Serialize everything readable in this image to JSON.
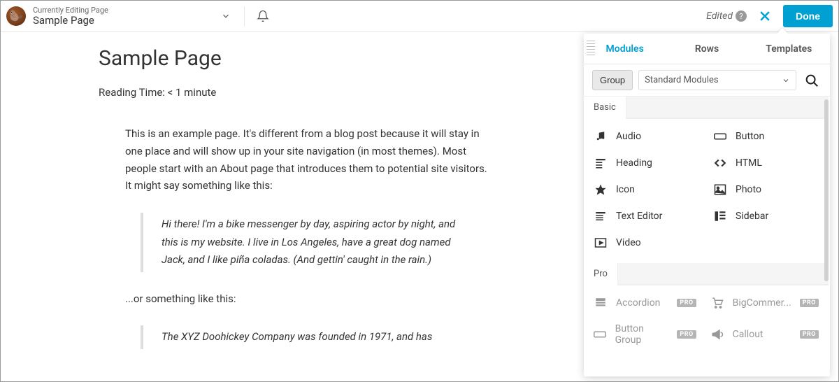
{
  "topbar": {
    "editing_label": "Currently Editing Page",
    "page_name": "Sample Page",
    "edited_label": "Edited",
    "done_label": "Done"
  },
  "content": {
    "title": "Sample Page",
    "reading_time": "Reading Time: < 1 minute",
    "para1": "This is an example page. It's different from a blog post because it will stay in one place and will show up in your site navigation (in most themes). Most people start with an About page that introduces them to potential site visitors. It might say something like this:",
    "quote1": "Hi there! I'm a bike messenger by day, aspiring actor by night, and this is my website. I live in Los Angeles, have a great dog named Jack, and I like piña coladas. (And gettin' caught in the rain.)",
    "para2": "...or something like this:",
    "quote2": "The XYZ Doohickey Company was founded in 1971, and has"
  },
  "panel": {
    "tabs": [
      "Modules",
      "Rows",
      "Templates"
    ],
    "active_tab": 0,
    "group_label": "Group",
    "filter_value": "Standard Modules",
    "sections": {
      "basic": {
        "label": "Basic",
        "items": [
          {
            "label": "Audio",
            "icon": "audio"
          },
          {
            "label": "Button",
            "icon": "button"
          },
          {
            "label": "Heading",
            "icon": "heading"
          },
          {
            "label": "HTML",
            "icon": "html"
          },
          {
            "label": "Icon",
            "icon": "icon"
          },
          {
            "label": "Photo",
            "icon": "photo"
          },
          {
            "label": "Text Editor",
            "icon": "text"
          },
          {
            "label": "Sidebar",
            "icon": "sidebar"
          },
          {
            "label": "Video",
            "icon": "video"
          }
        ]
      },
      "pro": {
        "label": "Pro",
        "badge": "PRO",
        "items": [
          {
            "label": "Accordion",
            "icon": "accordion"
          },
          {
            "label": "BigCommer...",
            "icon": "cart"
          },
          {
            "label": "Button Group",
            "icon": "button"
          },
          {
            "label": "Callout",
            "icon": "callout"
          }
        ]
      }
    }
  }
}
